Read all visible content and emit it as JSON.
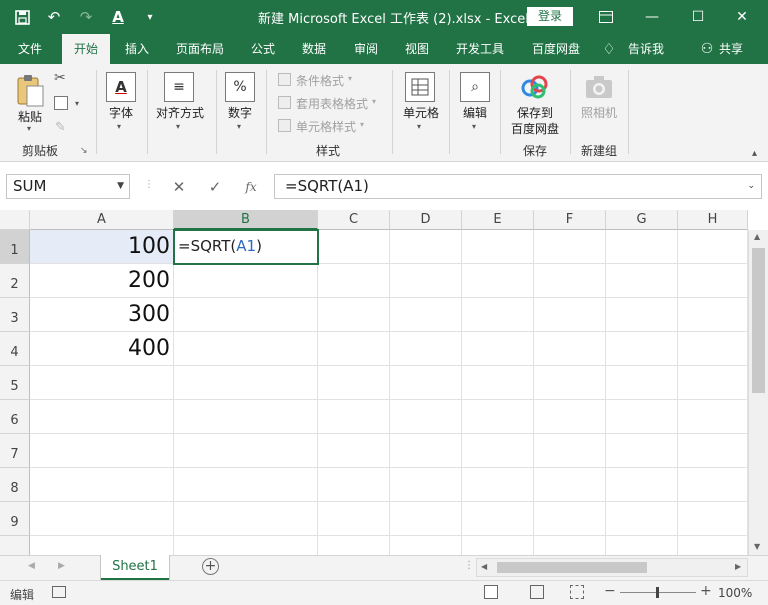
{
  "titlebar": {
    "title": "新建 Microsoft Excel 工作表 (2).xlsx  -  Excel",
    "login_label": "登录",
    "icons": [
      "save-icon",
      "undo-icon",
      "redo-icon",
      "font-color-icon",
      "customize-qat-icon",
      "ribbon-display-icon",
      "minimize-icon",
      "maximize-icon",
      "close-icon"
    ]
  },
  "tabs": [
    "文件",
    "开始",
    "插入",
    "页面布局",
    "公式",
    "数据",
    "审阅",
    "视图",
    "开发工具",
    "百度网盘",
    "告诉我",
    "共享"
  ],
  "active_tab": "开始",
  "ribbon": {
    "paste": "粘贴",
    "clipboard_group": "剪贴板",
    "font": "字体",
    "alignment": "对齐方式",
    "number": "数字",
    "conditional_format": "条件格式",
    "table_format": "套用表格格式",
    "cell_style": "单元格样式",
    "styles_group": "样式",
    "cells": "单元格",
    "editing": "编辑",
    "save_to_line1": "保存到",
    "save_to_line2": "百度网盘",
    "save_group": "保存",
    "camera": "照相机",
    "new_group": "新建组"
  },
  "formula_bar": {
    "name_box": "SUM",
    "formula": "=SQRT(A1)",
    "fx": "fx"
  },
  "grid": {
    "columns": [
      "A",
      "B",
      "C",
      "D",
      "E",
      "F",
      "G",
      "H"
    ],
    "rows": [
      "1",
      "2",
      "3",
      "4",
      "5",
      "6",
      "7",
      "8",
      "9"
    ],
    "values": {
      "A1": "100",
      "A2": "200",
      "A3": "300",
      "A4": "400"
    },
    "active_cell": "B1",
    "active_prefix": "=SQRT(",
    "active_ref": "A1",
    "active_suffix": ")"
  },
  "sheets": [
    "Sheet1"
  ],
  "status": {
    "mode": "编辑",
    "zoom": "100%"
  },
  "colors": {
    "accent": "#217346",
    "ref_blue": "#2f69c0",
    "selection": "#e5ecf7"
  }
}
